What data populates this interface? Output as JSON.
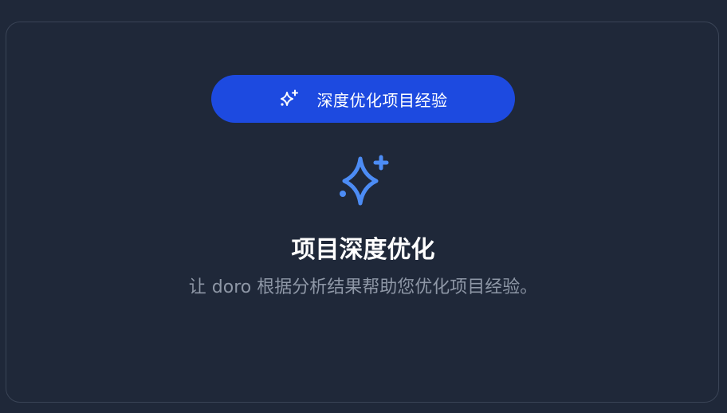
{
  "panel": {
    "button_label": "深度优化项目经验",
    "button_icon": "sparkles-icon",
    "hero_icon": "sparkles-icon",
    "title": "项目深度优化",
    "description": "让 doro 根据分析结果帮助您优化项目经验。"
  },
  "colors": {
    "background": "#1f2839",
    "button": "#1d4ae0",
    "accent": "#4c8cf5",
    "muted_text": "#8e97a6"
  }
}
